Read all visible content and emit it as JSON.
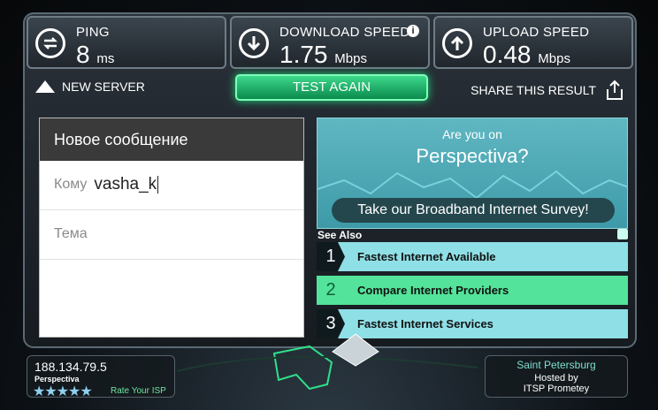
{
  "stats": {
    "ping": {
      "label": "PING",
      "value": "8",
      "unit": "ms"
    },
    "download": {
      "label": "DOWNLOAD SPEED",
      "value": "1.75",
      "unit": "Mbps",
      "info": "i"
    },
    "upload": {
      "label": "UPLOAD SPEED",
      "value": "0.48",
      "unit": "Mbps"
    }
  },
  "actions": {
    "new_server": "NEW SERVER",
    "test_again": "TEST AGAIN",
    "share": "SHARE THIS RESULT"
  },
  "message": {
    "title": "Новое сообщение",
    "to_label": "Кому",
    "to_value": "vasha_k",
    "subject_placeholder": "Тема"
  },
  "ad": {
    "question": "Are you on",
    "brand": "Perspectiva?",
    "survey": "Take our Broadband Internet Survey!",
    "see_also": "See Also",
    "links": [
      {
        "num": "1",
        "label": "Fastest Internet Available"
      },
      {
        "num": "2",
        "label": "Compare Internet Providers"
      },
      {
        "num": "3",
        "label": "Fastest Internet Services"
      }
    ]
  },
  "client": {
    "ip": "188.134.79.5",
    "isp": "Perspectiva",
    "stars": "★★★★★",
    "rate": "Rate Your ISP"
  },
  "server": {
    "city": "Saint Petersburg",
    "hosted_by": "Hosted by",
    "host": "ITSP Prometey"
  },
  "colors": {
    "accent_green": "#3dd98c",
    "ad_teal": "#5fb7c2"
  }
}
